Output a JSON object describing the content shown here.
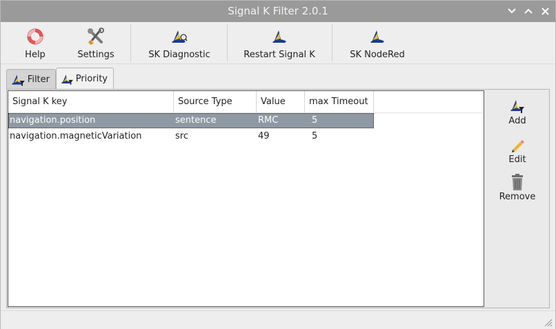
{
  "window": {
    "title": "Signal K Filter 2.0.1",
    "controls": [
      "chevron-down-icon",
      "chevron-up-icon",
      "close-icon"
    ]
  },
  "toolbar": {
    "help_label": "Help",
    "settings_label": "Settings",
    "diagnostic_label": "SK Diagnostic",
    "restart_label": "Restart Signal K",
    "nodered_label": "SK NodeRed"
  },
  "tabs": [
    {
      "label": "Filter",
      "active": false
    },
    {
      "label": "Priority",
      "active": true
    }
  ],
  "table": {
    "columns": [
      "Signal K key",
      "Source Type",
      "Value",
      "max Timeout"
    ],
    "rows": [
      {
        "key": "navigation.position",
        "source_type": "sentence",
        "value": "RMC",
        "timeout": "5",
        "selected": true
      },
      {
        "key": "navigation.magneticVariation",
        "source_type": "src",
        "value": "49",
        "timeout": "5",
        "selected": false
      }
    ]
  },
  "actions": {
    "add_label": "Add",
    "edit_label": "Edit",
    "remove_label": "Remove"
  },
  "colors": {
    "titlebar": "#9a9a9a",
    "selection": "#8f99a3",
    "signalk_blue": "#1f3a93",
    "signalk_yellow": "#f0c419"
  }
}
